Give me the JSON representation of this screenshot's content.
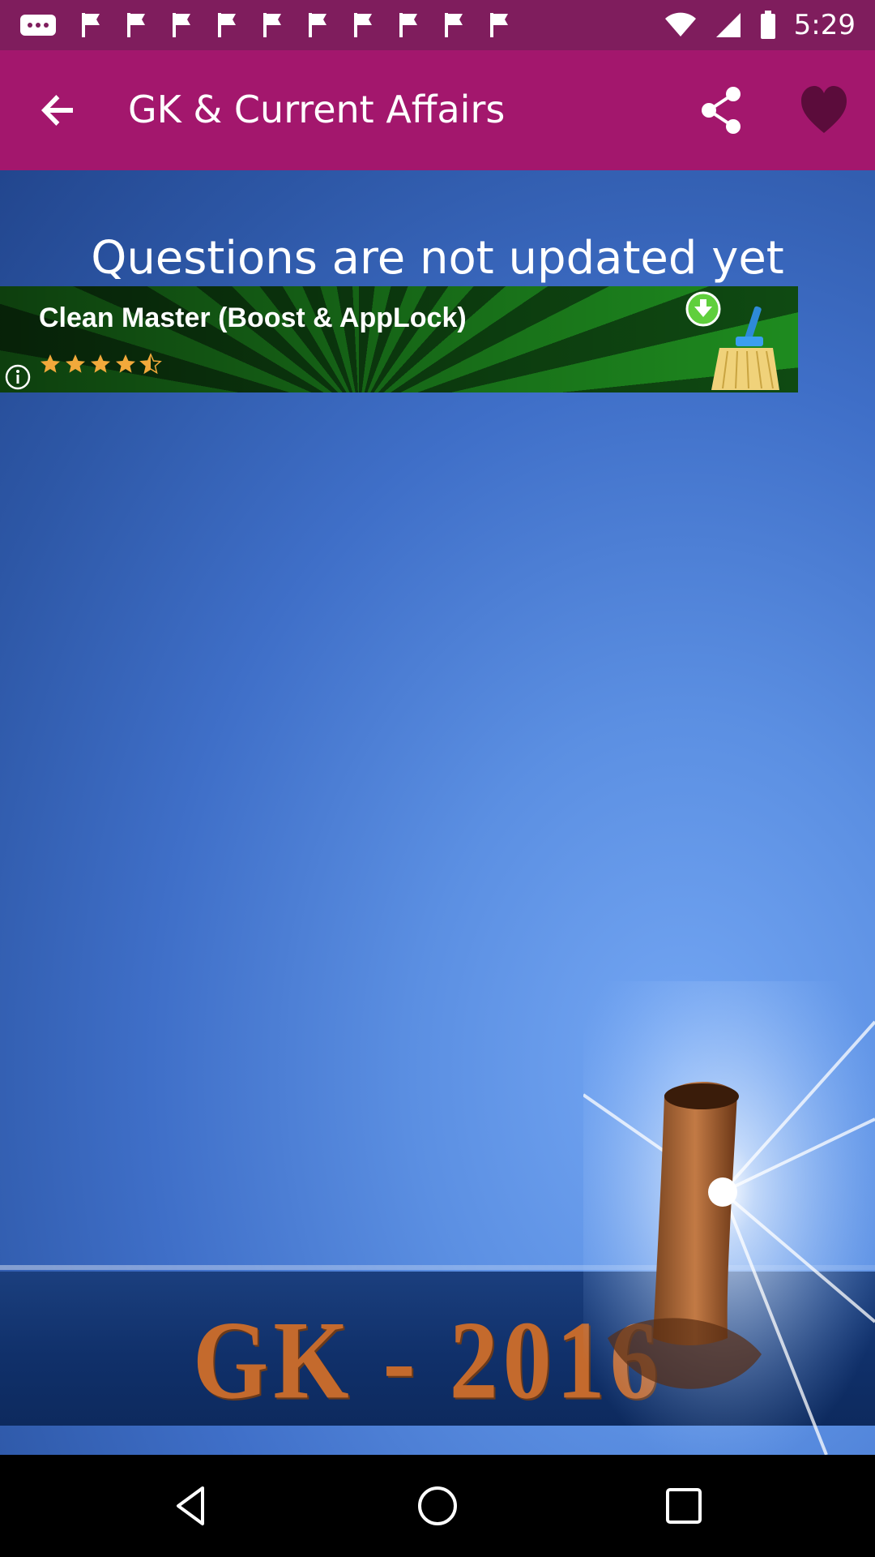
{
  "status_bar": {
    "time": "5:29",
    "notification_icons": [
      "more-notifications-icon",
      "flag-icon",
      "flag-icon",
      "flag-icon",
      "flag-icon",
      "flag-icon",
      "flag-icon",
      "flag-icon",
      "flag-icon",
      "flag-icon",
      "flag-icon"
    ],
    "system_icons": [
      "wifi-icon",
      "signal-icon",
      "battery-icon"
    ]
  },
  "app_bar": {
    "title": "GK & Current Affairs",
    "back_icon": "back-arrow-icon",
    "share_icon": "share-icon",
    "favorite_icon": "heart-icon",
    "background_color": "#a3176d"
  },
  "content": {
    "message": "Questions are not updated yet"
  },
  "ad": {
    "title": "Clean Master (Boost & AppLock)",
    "rating_stars": 4.5,
    "info_icon": "info-icon",
    "download_icon": "download-icon",
    "app_icon": "broom-icon"
  },
  "poster": {
    "text": "GK - 2016"
  },
  "nav_bar": {
    "buttons": [
      "back-triangle-icon",
      "home-circle-icon",
      "recents-square-icon"
    ]
  }
}
